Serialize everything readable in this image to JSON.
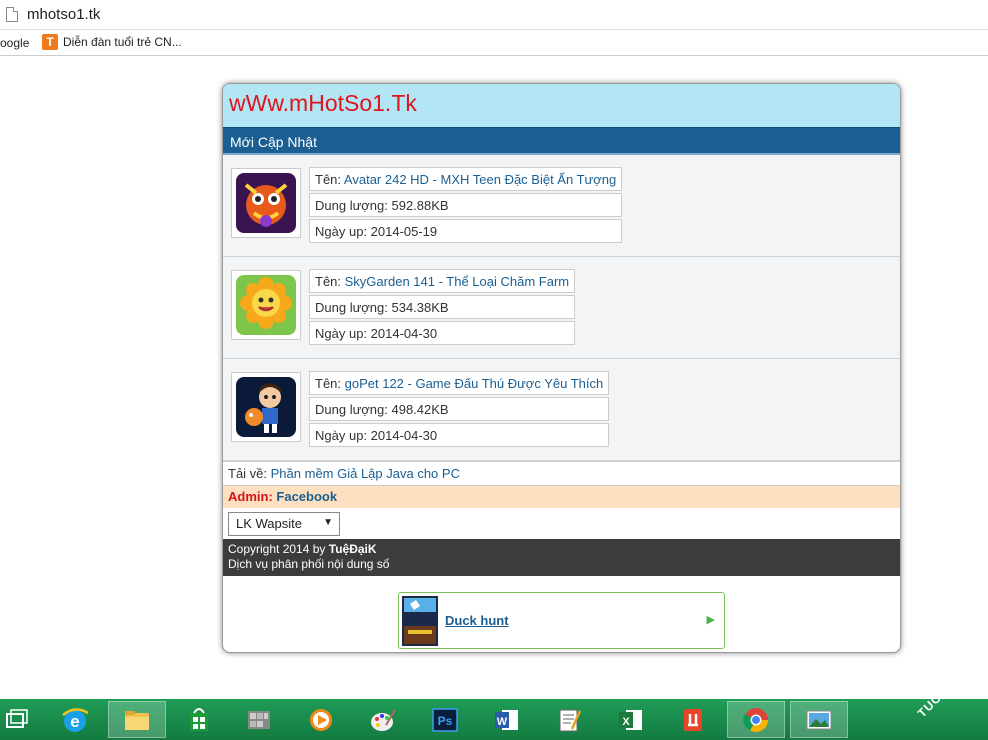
{
  "browser": {
    "url": "mhotso1.tk",
    "bookmarks": [
      {
        "label": "oogle"
      },
      {
        "label": "Diễn đàn tuổi trẻ CN..."
      }
    ]
  },
  "site": {
    "logo": "wWw.mHotSo1.Tk",
    "section_title": "Mới Cập Nhật",
    "items": [
      {
        "name_label": "Tên:",
        "name": "Avatar 242 HD - MXH Teen Đặc Biệt Ấn Tượng",
        "size": "Dung lượng: 592.88KB",
        "date": "Ngày up: 2014-05-19",
        "icon": "avatar-dragon-icon"
      },
      {
        "name_label": "Tên:",
        "name": "SkyGarden 141 - Thể Loại Chăm Farm",
        "size": "Dung lượng: 534.38KB",
        "date": "Ngày up: 2014-04-30",
        "icon": "sunflower-icon"
      },
      {
        "name_label": "Tên:",
        "name": "goPet 122 - Game Đấu Thú Được Yêu Thích",
        "size": "Dung lượng: 498.42KB",
        "date": "Ngày up: 2014-04-30",
        "icon": "gopet-character-icon"
      }
    ],
    "download": {
      "label": "Tải về:",
      "link": "Phần mềm Giả Lập Java cho PC"
    },
    "admin": {
      "label": "Admin:",
      "link": "Facebook"
    },
    "select": {
      "value": "LK Wapsite"
    },
    "footer": {
      "copyright_prefix": "Copyright 2014 by",
      "author": "TuệĐạiK",
      "tagline": "Dịch vụ phân phối nội dung số"
    },
    "ad": {
      "title": "Duck hunt"
    }
  },
  "taskbar": {
    "watermark": "TUOITREIT.VN"
  },
  "colors": {
    "logo_bg": "#b3e6f5",
    "logo_text": "#e0141c",
    "section_bg": "#1b5f92",
    "admin_bg": "#fde0c0",
    "footer_bg": "#3c3c3c",
    "taskbar": "#1a8c4c"
  }
}
